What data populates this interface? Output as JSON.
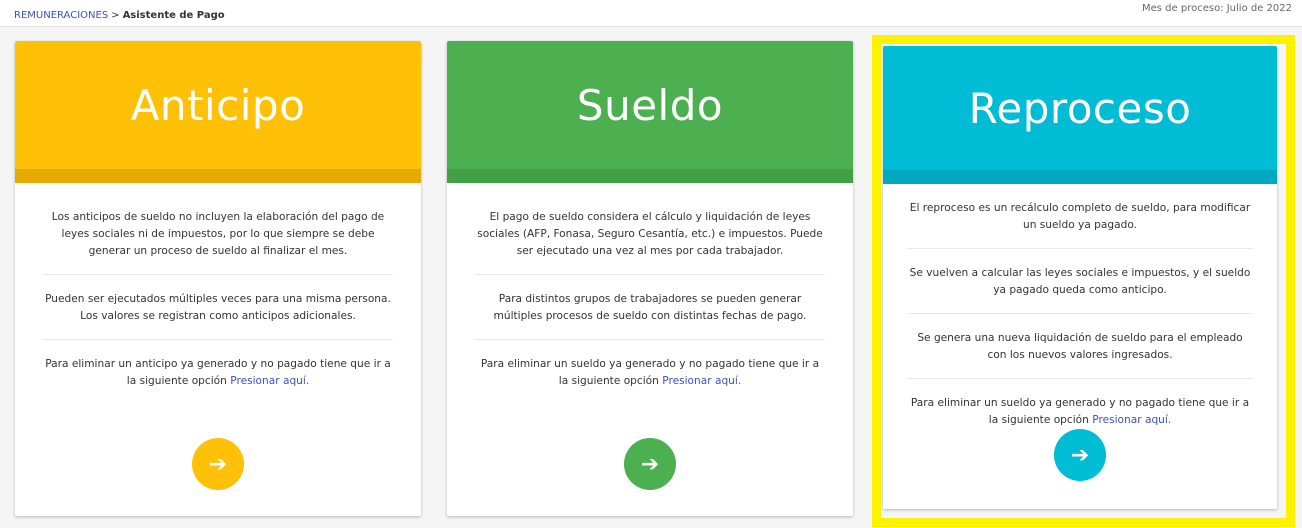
{
  "breadcrumb": {
    "root": "REMUNERACIONES",
    "separator": ">",
    "current": "Asistente de Pago"
  },
  "period": "Mes de proceso: Julio de 2022",
  "colors": {
    "anticipo": "#ffc107",
    "anticipo_dark": "#e6ab00",
    "sueldo": "#4caf50",
    "sueldo_dark": "#43a047",
    "reproceso": "#00bcd4",
    "reproceso_dark": "#00a9bd",
    "highlight": "#fff200",
    "link": "#3f51b5"
  },
  "cards": [
    {
      "title": "Anticipo",
      "paragraphs": [
        "Los anticipos de sueldo no incluyen la elaboración del pago de leyes sociales ni de impuestos, por lo que siempre se debe generar un proceso de sueldo al finalizar el mes.",
        "Pueden ser ejecutados múltiples veces para una misma persona. Los valores se registran como anticipos adicionales."
      ],
      "delete_text": "Para eliminar un anticipo ya generado y no pagado tiene que ir a la siguiente opción",
      "link": "Presionar aquí.",
      "button_icon": "arrow-right-icon"
    },
    {
      "title": "Sueldo",
      "paragraphs": [
        "El pago de sueldo considera el cálculo y liquidación de leyes sociales (AFP, Fonasa, Seguro Cesantía, etc.) e impuestos. Puede ser ejecutado una vez al mes por cada trabajador.",
        "Para distintos grupos de trabajadores se pueden generar múltiples procesos de sueldo con distintas fechas de pago."
      ],
      "delete_text": "Para eliminar un sueldo ya generado y no pagado tiene que ir a la siguiente opción",
      "link": "Presionar aquí.",
      "button_icon": "arrow-right-icon"
    },
    {
      "title": "Reproceso",
      "paragraphs": [
        "El reproceso es un recálculo completo de sueldo, para modificar un sueldo ya pagado.",
        "Se vuelven a calcular las leyes sociales e impuestos, y el sueldo ya pagado queda como anticipo.",
        "Se genera una nueva liquidación de sueldo para el empleado con los nuevos valores ingresados."
      ],
      "delete_text": "Para eliminar un sueldo ya generado y no pagado tiene que ir a la siguiente opción",
      "link": "Presionar aquí.",
      "button_icon": "arrow-right-icon"
    }
  ]
}
